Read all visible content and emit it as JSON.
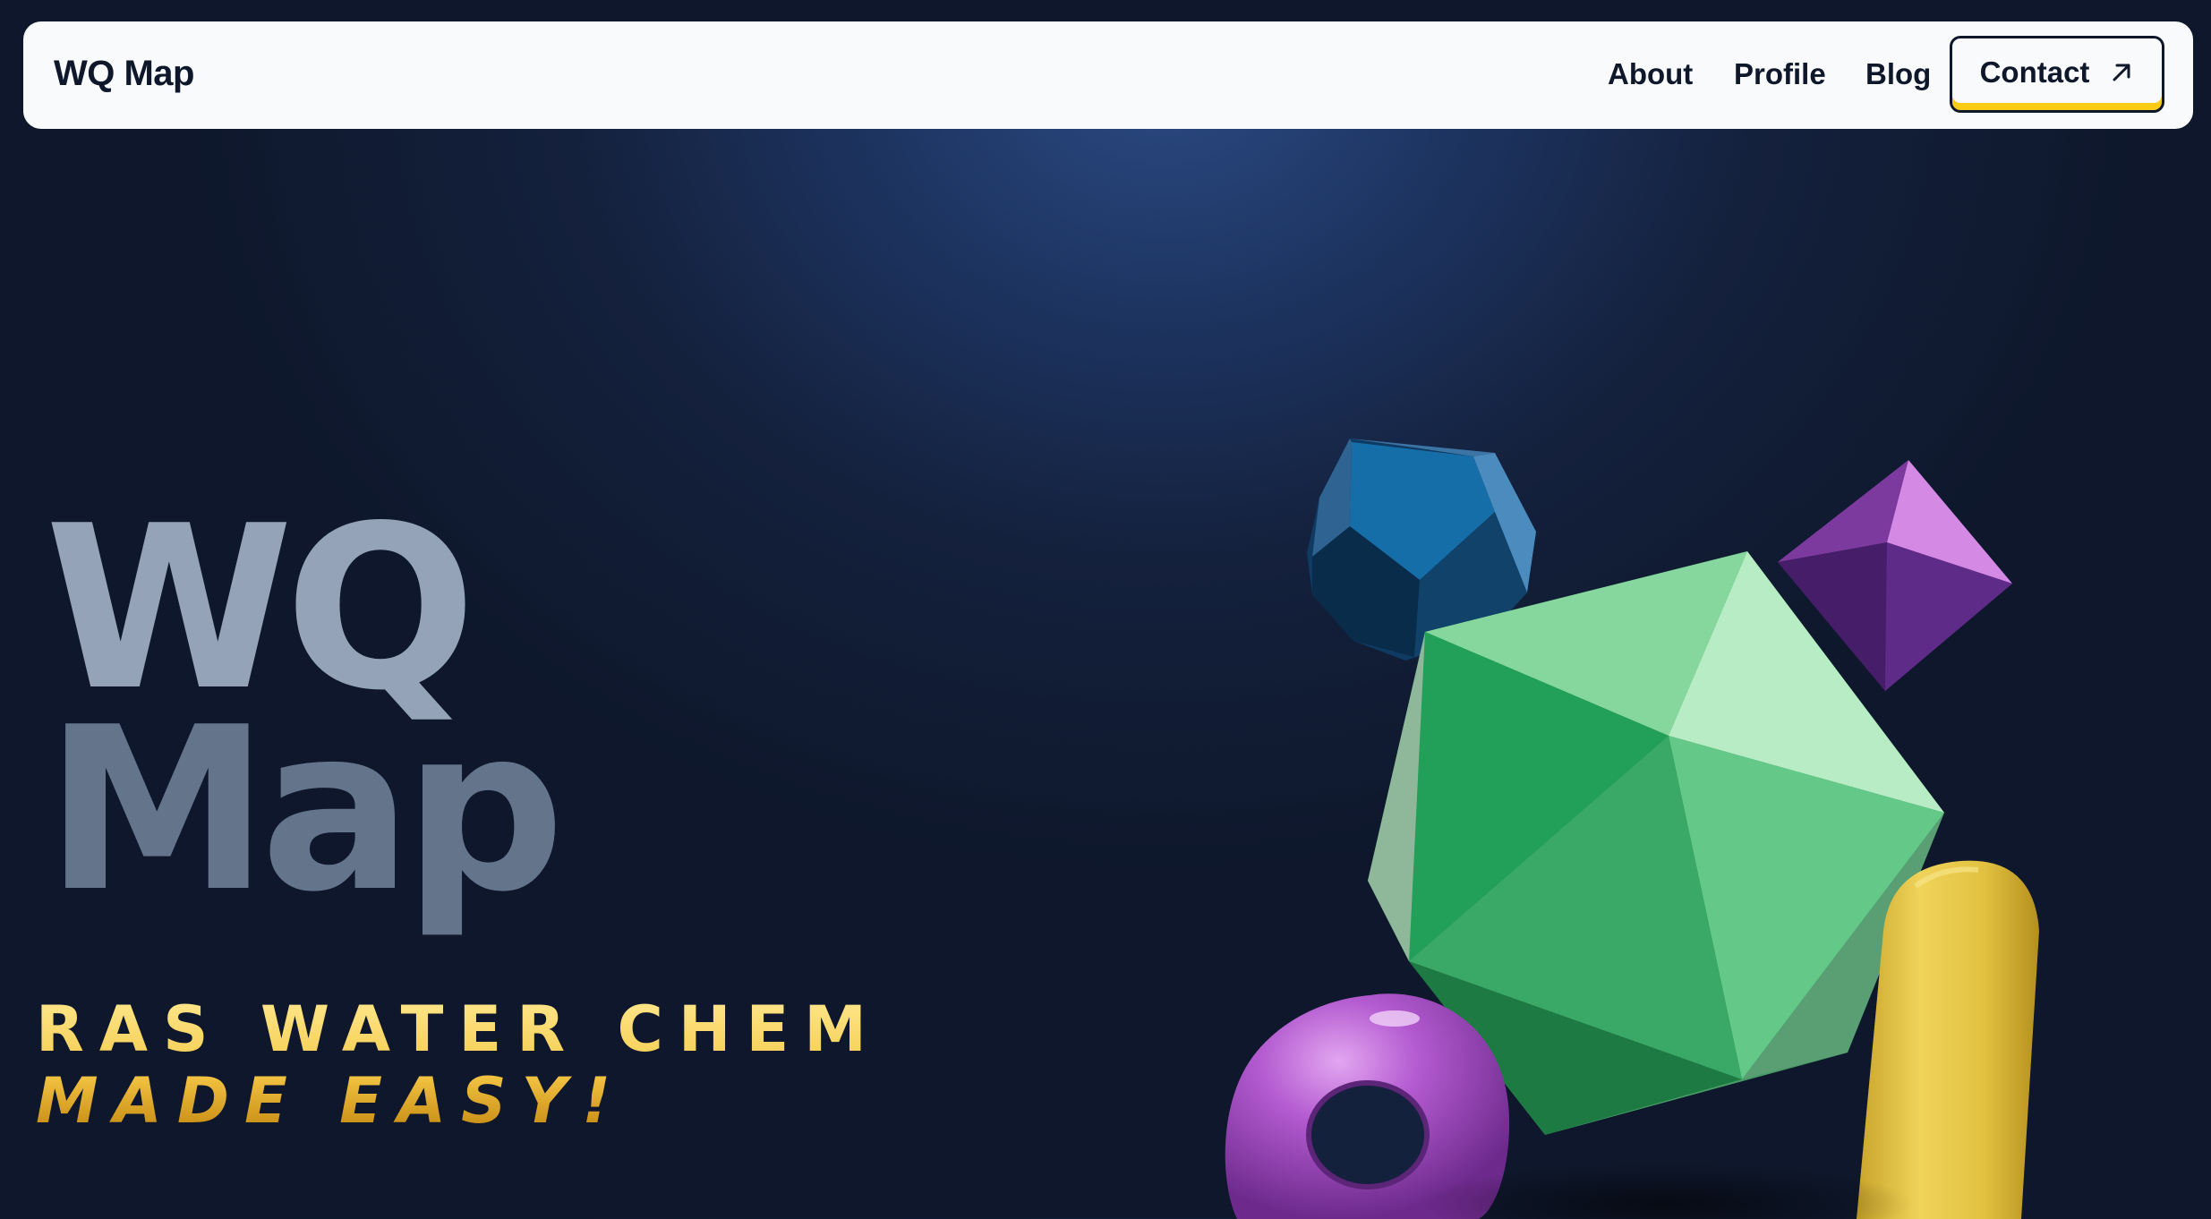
{
  "nav": {
    "brand": "WQ Map",
    "links": [
      "About",
      "Profile",
      "Blog"
    ],
    "contact_label": "Contact",
    "contact_icon": "arrow-up-right-icon"
  },
  "hero": {
    "title_line1": "WQ",
    "title_line2": "Map",
    "tagline_line1": "RAS WATER CHEM",
    "tagline_line2": "MADE EASY!"
  },
  "colors": {
    "background": "#14213d",
    "nav_bg": "#f8fafc",
    "accent": "#facc15",
    "title_light": "#94a3b8",
    "title_dark": "#64748b",
    "shape_blue": "#1e6aa0",
    "shape_green": "#22a05a",
    "shape_purple": "#7c3a9e",
    "shape_yellow": "#e6c33f",
    "shape_torus": "#a855c9"
  },
  "decor": [
    "dodecahedron-shape",
    "octahedron-shape",
    "icosahedron-shape",
    "torus-shape",
    "capsule-shape"
  ]
}
